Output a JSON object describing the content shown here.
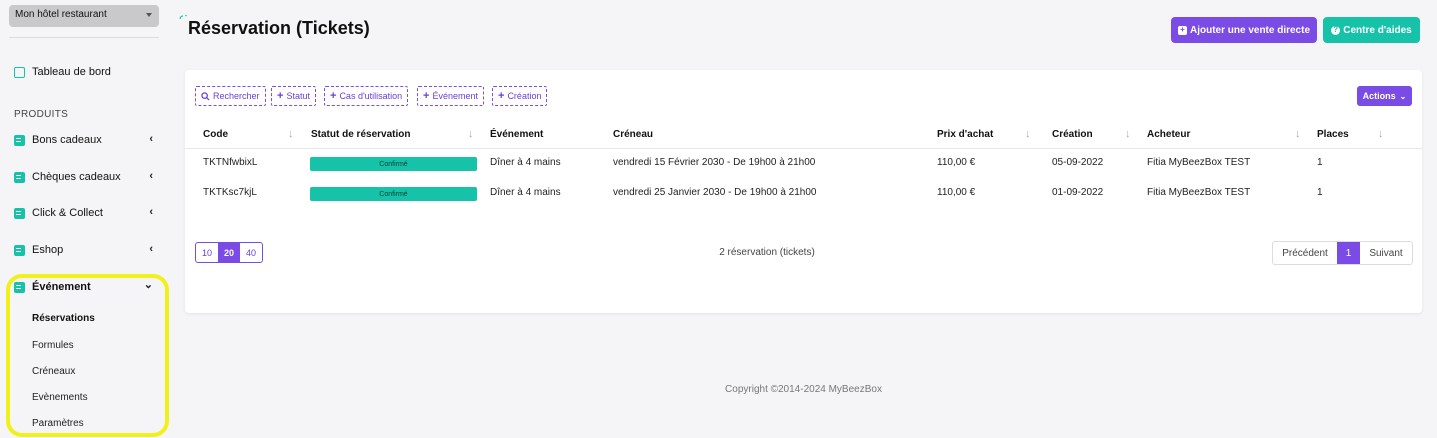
{
  "sidebar": {
    "hotel_select": "Mon hôtel restaurant",
    "dashboard_label": "Tableau de bord",
    "section_label": "PRODUITS",
    "items": [
      {
        "label": "Bons cadeaux",
        "chevron": "‹"
      },
      {
        "label": "Chèques cadeaux",
        "chevron": "‹"
      },
      {
        "label": "Click & Collect",
        "chevron": "‹"
      },
      {
        "label": "Eshop",
        "chevron": "‹"
      },
      {
        "label": "Événement",
        "chevron": "⌄"
      }
    ],
    "sub_items": [
      "Réservations",
      "Formules",
      "Créneaux",
      "Evènements",
      "Paramètres"
    ],
    "active_sub_item": "Réservations",
    "highlight_color": "#f2f01a"
  },
  "header": {
    "title": "Réservation (Tickets)",
    "add_button": "Ajouter une vente directe",
    "help_button": "Centre d'aides"
  },
  "filters": [
    "Rechercher",
    "Statut",
    "Cas d'utilisation",
    "Événement",
    "Création"
  ],
  "actions_button": "Actions",
  "table": {
    "columns": [
      "Code",
      "Statut de réservation",
      "Événement",
      "Créneau",
      "Prix d'achat",
      "Création",
      "Acheteur",
      "Places"
    ],
    "rows": [
      {
        "code": "TKTNfwbixL",
        "status": "Confirmé",
        "event": "Dîner à 4 mains",
        "slot": "vendredi 15 Février 2030 - De 19h00 à 21h00",
        "price": "110,00 €",
        "created": "05-09-2022",
        "buyer": "Fitia MyBeezBox TEST",
        "places": "1"
      },
      {
        "code": "TKTKsc7kjL",
        "status": "Confirmé",
        "event": "Dîner à 4 mains",
        "slot": "vendredi 25 Janvier 2030 - De 19h00 à 21h00",
        "price": "110,00 €",
        "created": "01-09-2022",
        "buyer": "Fitia MyBeezBox TEST",
        "places": "1"
      }
    ]
  },
  "pager": {
    "sizes": [
      "10",
      "20",
      "40"
    ],
    "selected_size": "20",
    "count_text": "2 réservation (tickets)",
    "prev": "Précédent",
    "current": "1",
    "next": "Suivant"
  },
  "footer": "Copyright ©2014-2024 MyBeezBox",
  "colors": {
    "accent": "#7b4be6",
    "teal": "#17c3a8"
  }
}
